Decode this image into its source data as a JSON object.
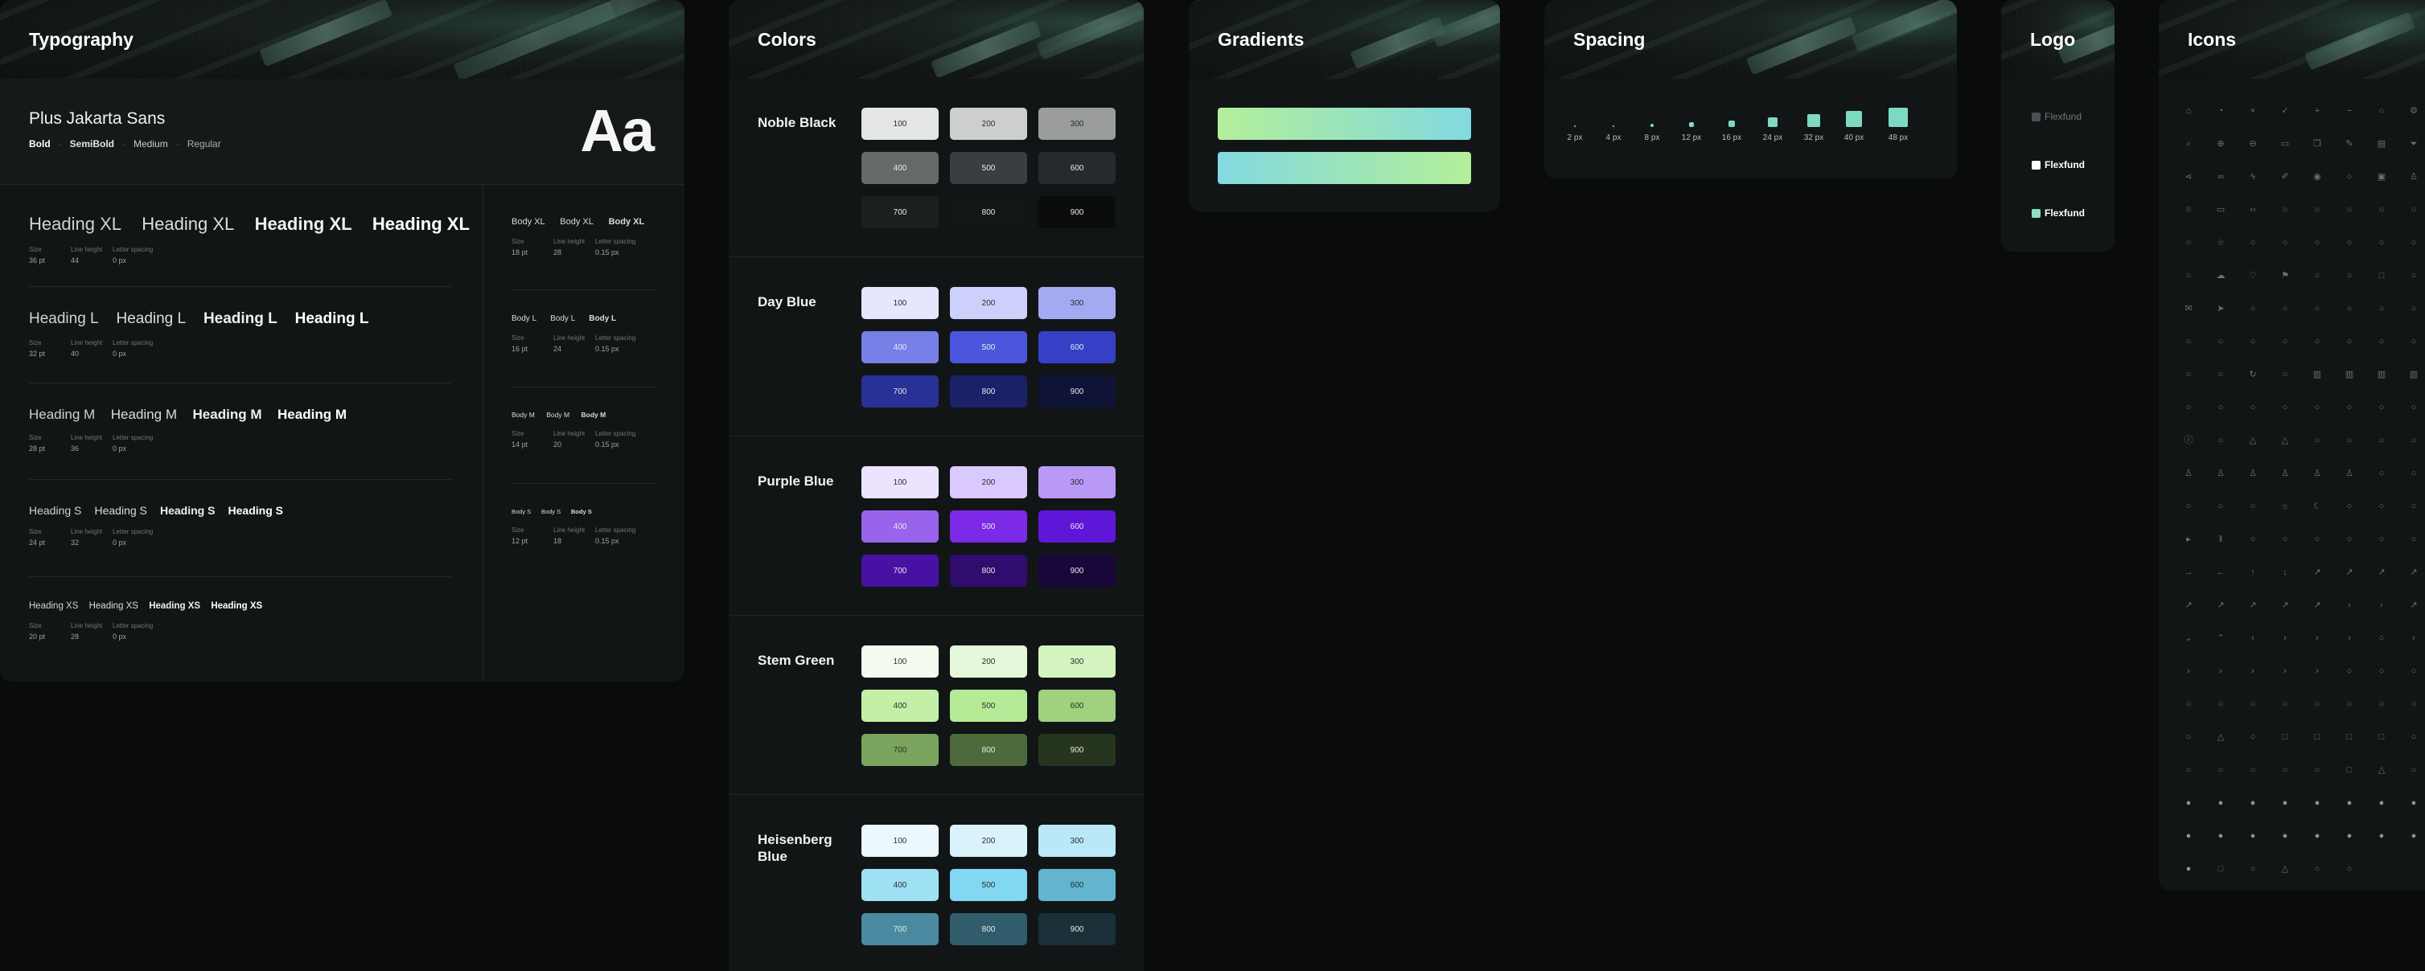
{
  "typography": {
    "title": "Typography",
    "font_name": "Plus Jakarta Sans",
    "weights": [
      "Bold",
      "SemiBold",
      "Medium",
      "Regular"
    ],
    "sample_glyph": "Aa",
    "meta_labels": {
      "size": "Size",
      "line_height": "Line height",
      "letter_spacing": "Letter spacing"
    },
    "headings": [
      {
        "label": "Heading XL",
        "size": "36 pt",
        "line_height": "44",
        "letter_spacing": "0 px"
      },
      {
        "label": "Heading L",
        "size": "32 pt",
        "line_height": "40",
        "letter_spacing": "0 px"
      },
      {
        "label": "Heading M",
        "size": "28 pt",
        "line_height": "36",
        "letter_spacing": "0 px"
      },
      {
        "label": "Heading S",
        "size": "24 pt",
        "line_height": "32",
        "letter_spacing": "0 px"
      },
      {
        "label": "Heading XS",
        "size": "20 pt",
        "line_height": "28",
        "letter_spacing": "0 px"
      }
    ],
    "body": [
      {
        "label": "Body XL",
        "size": "18 pt",
        "line_height": "28",
        "letter_spacing": "0.15 px"
      },
      {
        "label": "Body L",
        "size": "16 pt",
        "line_height": "24",
        "letter_spacing": "0.15 px"
      },
      {
        "label": "Body M",
        "size": "14 pt",
        "line_height": "20",
        "letter_spacing": "0.15 px"
      },
      {
        "label": "Body S",
        "size": "12 pt",
        "line_height": "18",
        "letter_spacing": "0.15 px"
      }
    ]
  },
  "colors": {
    "title": "Colors",
    "groups": [
      {
        "name": "Noble Black",
        "swatches": [
          {
            "label": "100",
            "hex": "#e4e5e5"
          },
          {
            "label": "200",
            "hex": "#cdcecf"
          },
          {
            "label": "300",
            "hex": "#9a9c9d"
          },
          {
            "label": "400",
            "hex": "#66696a"
          },
          {
            "label": "500",
            "hex": "#3b3e40"
          },
          {
            "label": "600",
            "hex": "#262a2c"
          },
          {
            "label": "700",
            "hex": "#1b1f20"
          },
          {
            "label": "800",
            "hex": "#131617"
          },
          {
            "label": "900",
            "hex": "#0b0d0d"
          }
        ]
      },
      {
        "name": "Day Blue",
        "swatches": [
          {
            "label": "100",
            "hex": "#e5e7ff"
          },
          {
            "label": "200",
            "hex": "#ccd0fb"
          },
          {
            "label": "300",
            "hex": "#a4aaf2"
          },
          {
            "label": "400",
            "hex": "#7780e7"
          },
          {
            "label": "500",
            "hex": "#4c56dc"
          },
          {
            "label": "600",
            "hex": "#3540c6"
          },
          {
            "label": "700",
            "hex": "#283195"
          },
          {
            "label": "800",
            "hex": "#1b2168"
          },
          {
            "label": "900",
            "hex": "#0f1337"
          }
        ]
      },
      {
        "name": "Purple Blue",
        "swatches": [
          {
            "label": "100",
            "hex": "#ece4ff"
          },
          {
            "label": "200",
            "hex": "#d9c9fe"
          },
          {
            "label": "300",
            "hex": "#b999f6"
          },
          {
            "label": "400",
            "hex": "#9a63ec"
          },
          {
            "label": "500",
            "hex": "#7c2ae8"
          },
          {
            "label": "600",
            "hex": "#6016d8"
          },
          {
            "label": "700",
            "hex": "#4712a4"
          },
          {
            "label": "800",
            "hex": "#2f0c6e"
          },
          {
            "label": "900",
            "hex": "#180738"
          }
        ]
      },
      {
        "name": "Stem Green",
        "swatches": [
          {
            "label": "100",
            "hex": "#f3fbee"
          },
          {
            "label": "200",
            "hex": "#e4f8d9"
          },
          {
            "label": "300",
            "hex": "#d3f4be"
          },
          {
            "label": "400",
            "hex": "#c3f0a6"
          },
          {
            "label": "500",
            "hex": "#b5eb96"
          },
          {
            "label": "600",
            "hex": "#9fd17f"
          },
          {
            "label": "700",
            "hex": "#7aa45d"
          },
          {
            "label": "800",
            "hex": "#4d6b3a"
          },
          {
            "label": "900",
            "hex": "#26351d"
          }
        ]
      },
      {
        "name": "Heisenberg Blue",
        "swatches": [
          {
            "label": "100",
            "hex": "#ecf8fd"
          },
          {
            "label": "200",
            "hex": "#d9f2fb"
          },
          {
            "label": "300",
            "hex": "#bbe8f7"
          },
          {
            "label": "400",
            "hex": "#9ee0f4"
          },
          {
            "label": "500",
            "hex": "#82d7f2"
          },
          {
            "label": "600",
            "hex": "#63b4cf"
          },
          {
            "label": "700",
            "hex": "#4a8aa0"
          },
          {
            "label": "800",
            "hex": "#305c6b"
          },
          {
            "label": "900",
            "hex": "#1a3039"
          }
        ]
      }
    ]
  },
  "gradients": {
    "title": "Gradients",
    "items": [
      {
        "from": "#b3ef99",
        "to": "#82d9e0"
      },
      {
        "from": "#82d9e0",
        "to": "#b3ef99"
      }
    ]
  },
  "spacing": {
    "title": "Spacing",
    "items": [
      {
        "label": "2 px",
        "value": 2
      },
      {
        "label": "4 px",
        "value": 4
      },
      {
        "label": "8 px",
        "value": 8
      },
      {
        "label": "12 px",
        "value": 12
      },
      {
        "label": "16 px",
        "value": 16
      },
      {
        "label": "24 px",
        "value": 24
      },
      {
        "label": "32 px",
        "value": 32
      },
      {
        "label": "40 px",
        "value": 40
      },
      {
        "label": "48 px",
        "value": 48
      }
    ]
  },
  "logo": {
    "title": "Logo",
    "variants": [
      {
        "label": "Flexfund",
        "text_color": "#6e7677",
        "mark_color": "#4a5152"
      },
      {
        "label": "Flexfund",
        "text_color": "#ffffff",
        "mark_color": "#ffffff"
      },
      {
        "label": "Flexfund",
        "text_color": "#ffffff",
        "mark_color": "#8fe0c4"
      }
    ]
  },
  "icons": {
    "title": "Icons",
    "rows": [
      [
        "home-icon",
        "bell-icon",
        "close-icon",
        "check-icon",
        "plus-icon",
        "minus-icon",
        "plus-circle-icon",
        "gear-icon",
        "settings-icon"
      ],
      [
        "search-icon",
        "zoom-in-icon",
        "zoom-out-icon",
        "document-icon",
        "copy-icon",
        "edit-icon",
        "clipboard-icon",
        "filter-icon",
        "edit-box-icon"
      ],
      [
        "share-icon",
        "link-icon",
        "lightning-icon",
        "pen-icon",
        "eye-icon",
        "eye-off-icon",
        "lock-icon",
        "user-icon",
        "more-icon"
      ],
      [
        "location-icon",
        "wallet-icon",
        "code-icon",
        "attachment-icon",
        "cart-icon",
        "target-icon",
        "globe-icon",
        "map-icon",
        "chart-icon"
      ],
      [
        "download-icon",
        "star-icon",
        "tag-icon",
        "calendar-icon",
        "book-icon",
        "grid-icon",
        "list-icon",
        "layers-icon",
        "sliders-icon"
      ],
      [
        "image-icon",
        "cloud-icon",
        "heart-icon",
        "flag-icon",
        "bookmark-icon",
        "folder-icon",
        "inbox-icon",
        "printer-icon",
        "phone-icon"
      ],
      [
        "mail-icon",
        "send-icon",
        "archive-icon",
        "camera-icon",
        "message-icon",
        "chat-icon",
        "comment-icon",
        "video-icon",
        "mic-icon"
      ],
      [
        "shield-icon",
        "key-icon",
        "pin-icon",
        "dollar-icon",
        "credit-card-icon",
        "coin-icon",
        "bank-icon",
        "trend-icon",
        "pie-icon"
      ],
      [
        "award-icon",
        "gift-icon",
        "refresh-icon",
        "clock-icon",
        "bar-chart-icon",
        "column-chart-icon",
        "line-chart-icon",
        "area-chart-icon",
        "funnel-icon"
      ],
      [
        "monitor-icon",
        "laptop-icon",
        "tablet-icon",
        "mobile-icon",
        "server-icon",
        "database-icon",
        "wifi-icon",
        "bluetooth-icon",
        "battery-icon"
      ],
      [
        "info-icon",
        "help-icon",
        "alert-icon",
        "warning-icon",
        "error-icon",
        "history-icon",
        "timer-icon",
        "hourglass-icon",
        "calendar-check-icon"
      ],
      [
        "user-add-icon",
        "user-check-icon",
        "users-icon",
        "user-remove-icon",
        "user-circle-icon",
        "team-icon",
        "contact-icon",
        "id-card-icon",
        "handshake-icon"
      ],
      [
        "walk-icon",
        "run-icon",
        "accessibility-icon",
        "sun-icon",
        "moon-icon",
        "cloud-rain-icon",
        "drop-icon",
        "wind-icon",
        "thermometer-icon"
      ],
      [
        "play-icon",
        "pause-icon",
        "stop-icon",
        "skip-icon",
        "volume-icon",
        "mute-icon",
        "music-icon",
        "headphones-icon",
        "radio-icon"
      ],
      [
        "arrow-right-icon",
        "arrow-left-icon",
        "arrow-up-icon",
        "arrow-down-icon",
        "arrow-up-long-icon",
        "arrow-up-thin-icon",
        "arrow-down-thin-icon",
        "arrow-left-thin-icon",
        "arrow-right-thin-icon"
      ],
      [
        "arrow-down-right-icon",
        "arrow-down-left-icon",
        "arrow-diag-icon",
        "arrow-up-right-icon",
        "arrow-up-left-icon",
        "caret-left-icon",
        "caret-right-icon",
        "arrow-corner-icon",
        "arrow-turn-icon"
      ],
      [
        "chevron-down-icon",
        "chevron-up-icon",
        "chevron-left-icon",
        "chevron-right-icon",
        "chevron-down-small-icon",
        "chevron-up-small-icon",
        "dash-icon",
        "chevron-end-icon",
        "chevron-start-icon"
      ],
      [
        "double-chevron-right-icon",
        "double-chevron-left-icon",
        "double-chevron-up-icon",
        "double-chevron-down-icon",
        "chevrons-icon",
        "sort-icon",
        "swap-icon",
        "move-icon",
        "expand-icon"
      ],
      [
        "rotate-icon",
        "undo-icon",
        "maximize-icon",
        "minimize-icon",
        "fullscreen-icon",
        "crop-icon",
        "frame-icon",
        "resize-icon",
        "external-icon"
      ],
      [
        "info-circle-icon",
        "alert-triangle-icon",
        "help-circle-icon",
        "x-square-icon",
        "check-square-icon",
        "minus-square-icon",
        "plus-square-icon",
        "octagon-icon",
        "square-icon"
      ],
      [
        "circle-outline-icon",
        "x-circle-icon",
        "check-circle-icon",
        "minus-circle-icon",
        "slash-icon",
        "info-square-icon",
        "alert-octagon-icon",
        "stop-circle-icon",
        "box-icon"
      ],
      [
        "check-filled-icon",
        "warning-filled-icon",
        "minus-filled-icon",
        "x-filled-icon",
        "info-filled-icon",
        "alert-filled-icon",
        "help-filled-icon",
        "star-filled-icon",
        "heart-filled-icon"
      ],
      [
        "close-filled-icon",
        "triangle-filled-icon",
        "square-filled-icon",
        "flag-filled-icon",
        "shield-filled-icon",
        "bell-filled-icon",
        "circle-filled-icon",
        "plus-filled-icon",
        "checkbox-filled-icon"
      ],
      [
        "dot-filled-icon",
        "square-outline-icon",
        "circle-thin-icon",
        "triangle-outline-icon",
        "pentagon-icon",
        "hexagon-icon"
      ]
    ]
  }
}
